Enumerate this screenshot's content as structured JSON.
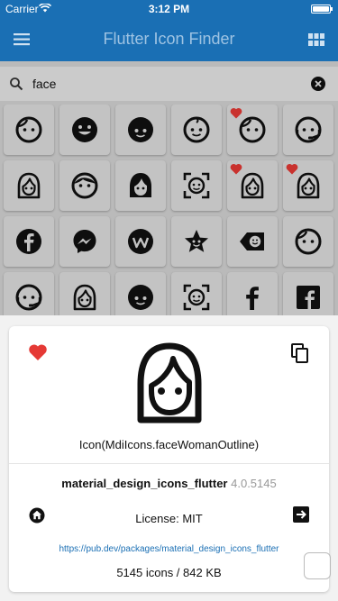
{
  "statusbar": {
    "carrier": "Carrier",
    "time": "3:12 PM"
  },
  "appbar": {
    "title": "Flutter Icon Finder"
  },
  "search": {
    "value": "face",
    "placeholder": ""
  },
  "colors": {
    "primary": "#1a6fb4",
    "favorite": "#e53935",
    "link": "#1a6fb4"
  },
  "grid_icons": [
    [
      "face-icon",
      "emoticon-happy-icon",
      "face-dark-icon",
      "baby-face-icon",
      "face-profile-favorite-icon",
      "face-agent-icon"
    ],
    [
      "face-woman-icon",
      "face-man-icon",
      "face-woman-dark-icon",
      "face-recognition-icon",
      "face-woman-favorite-icon",
      "face-woman-outline-favorite-icon"
    ],
    [
      "facebook-icon",
      "facebook-messenger-icon",
      "facebook-workplace-icon",
      "star-face-icon",
      "tag-faces-icon",
      "face-outline-icon"
    ],
    [
      "face-agent-outline-icon",
      "face-woman-line-icon",
      "face-man-dark-icon",
      "face-recognition-outline-icon",
      "facebook-f-icon",
      "facebook-box-icon"
    ]
  ],
  "detail": {
    "icon_name": "Icon(MdiIcons.faceWomanOutline)",
    "package_name": "material_design_icons_flutter",
    "package_version": "4.0.5145",
    "license": "License: MIT",
    "url": "https://pub.dev/packages/material_design_icons_flutter",
    "stats": "5145 icons / 842 KB"
  }
}
